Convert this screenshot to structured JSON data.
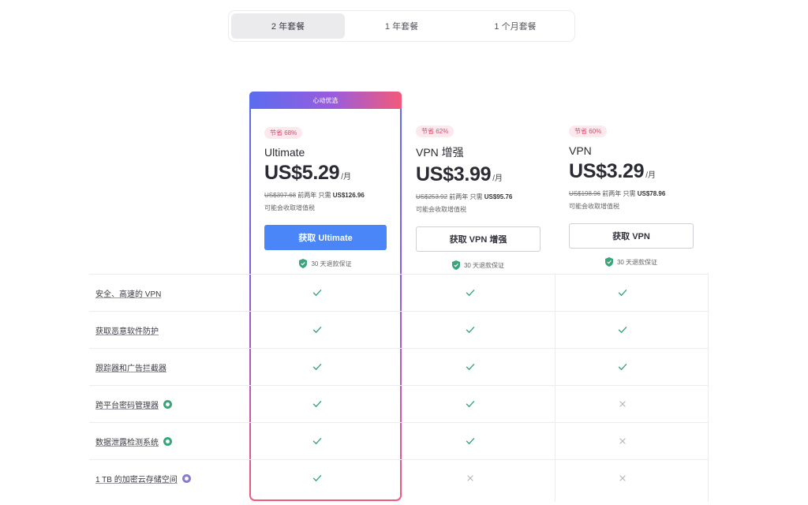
{
  "tabs": [
    {
      "label": "2 年套餐",
      "active": true
    },
    {
      "label": "1 年套餐",
      "active": false
    },
    {
      "label": "1 个月套餐",
      "active": false
    }
  ],
  "featured_banner": "心动优选",
  "plans": [
    {
      "badge": "节省 68%",
      "name": "Ultimate",
      "price": "US$5.29",
      "per": "/月",
      "original": "US$397.68",
      "billing_mid": "前两年 只需",
      "billing_total": "US$126.96",
      "tax": "可能会收取增值税",
      "cta": "获取 Ultimate",
      "guarantee": "30 天退款保证"
    },
    {
      "badge": "节省 62%",
      "name": "VPN 增强",
      "price": "US$3.99",
      "per": "/月",
      "original": "US$253.92",
      "billing_mid": "前两年 只需",
      "billing_total": "US$95.76",
      "tax": "可能会收取增值税",
      "cta": "获取 VPN 增强",
      "guarantee": "30 天退款保证"
    },
    {
      "badge": "节省 60%",
      "name": "VPN",
      "price": "US$3.29",
      "per": "/月",
      "original": "US$198.96",
      "billing_mid": "前两年 只需",
      "billing_total": "US$78.96",
      "tax": "可能会收取增值税",
      "cta": "获取 VPN",
      "guarantee": "30 天退款保证"
    }
  ],
  "features": [
    {
      "label": "安全、高速的 VPN",
      "addon": "",
      "included": [
        true,
        true,
        true
      ]
    },
    {
      "label": "获取恶意软件防护",
      "addon": "",
      "included": [
        true,
        true,
        true
      ]
    },
    {
      "label": "跟踪器和广告拦截器",
      "addon": "",
      "included": [
        true,
        true,
        true
      ]
    },
    {
      "label": "跨平台密码管理器",
      "addon": "green",
      "included": [
        true,
        true,
        false
      ]
    },
    {
      "label": "数据泄露检测系统",
      "addon": "green",
      "included": [
        true,
        true,
        false
      ]
    },
    {
      "label": "1 TB 的加密云存储空间",
      "addon": "purple",
      "included": [
        true,
        false,
        false
      ]
    }
  ],
  "colors": {
    "accent": "#4a86f7",
    "check": "#3aa57a",
    "cross": "#b5b5bd",
    "badge": "#e2456b"
  }
}
